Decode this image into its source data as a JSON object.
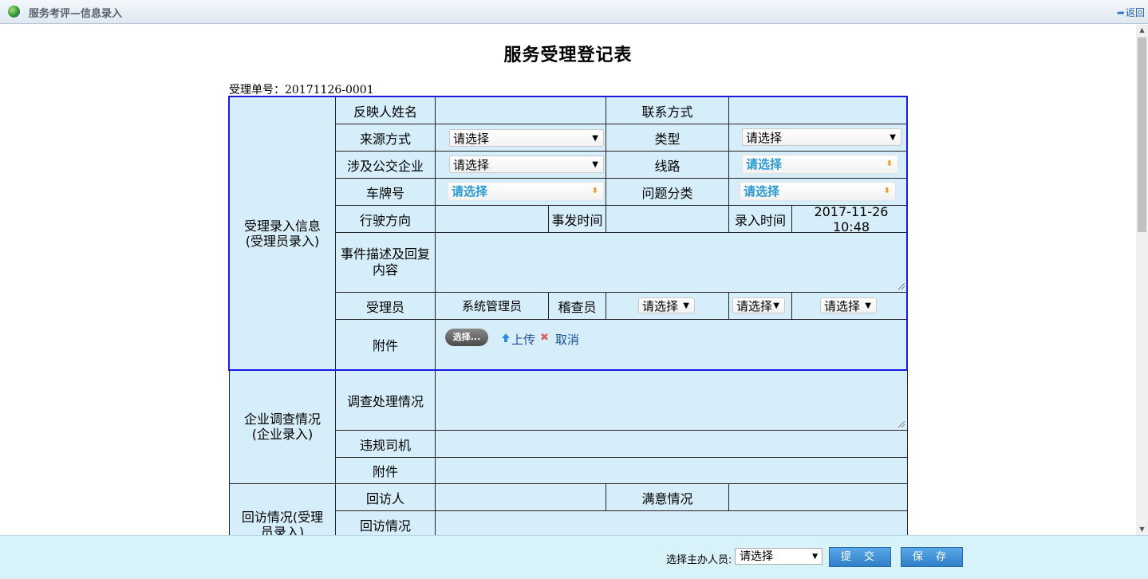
{
  "window": {
    "title": "服务考评—信息录入",
    "back_label": "返回"
  },
  "page": {
    "title": "服务受理登记表",
    "receipt_no": "受理单号：20171126-0001"
  },
  "sections": {
    "accept": {
      "label": "受理录入信息(受理员录入)"
    },
    "enterprise": {
      "label": "企业调查情况(企业录入)"
    },
    "visit": {
      "label": "回访情况(受理员录入)"
    }
  },
  "fields": {
    "reporter_name": "反映人姓名",
    "contact": "联系方式",
    "source": "来源方式",
    "type": "类型",
    "company": "涉及公交企业",
    "route": "线路",
    "plate": "车牌号",
    "problem_category": "问题分类",
    "direction": "行驶方向",
    "incident_time": "事发时间",
    "entry_time": "录入时间",
    "entry_time_value": "2017-11-26 10:48",
    "description": "事件描述及回复内容",
    "handler": "受理员",
    "handler_value": "系统管理员",
    "inspector": "稽查员",
    "attachment": "附件",
    "investigation": "调查处理情况",
    "violating_driver": "违规司机",
    "attachment2": "附件",
    "visitor": "回访人",
    "satisfaction": "满意情况",
    "visit_status": "回访情况"
  },
  "selects": {
    "placeholder": "请选择"
  },
  "attachment_controls": {
    "choose": "选择...",
    "upload": "上传",
    "cancel": "取消"
  },
  "footer": {
    "select_label": "选择主办人员:",
    "select_value": "请选择",
    "submit": "提 交",
    "save": "保 存"
  },
  "colors": {
    "form_bg": "#d5eefa",
    "section_border": "#1a1ae0",
    "button": "#3f8fd8"
  }
}
